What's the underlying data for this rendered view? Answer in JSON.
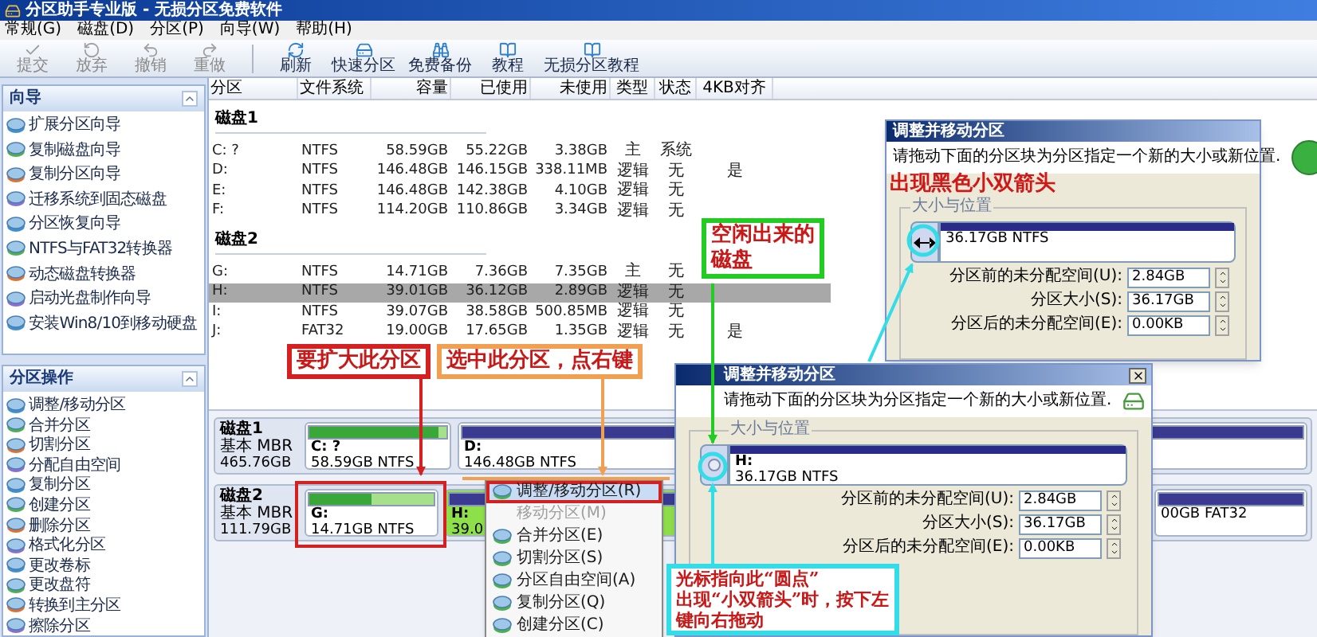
{
  "window": {
    "title": "分区助手专业版 - 无损分区免费软件"
  },
  "menu": [
    "常规(G)",
    "磁盘(D)",
    "分区(P)",
    "向导(W)",
    "帮助(H)"
  ],
  "toolbar": [
    {
      "label": "提交",
      "disabled": true
    },
    {
      "label": "放弃",
      "disabled": true
    },
    {
      "label": "撤销",
      "disabled": true
    },
    {
      "label": "重做",
      "disabled": true
    },
    {
      "label": "刷新",
      "disabled": false
    },
    {
      "label": "快速分区",
      "disabled": false
    },
    {
      "label": "免费备份",
      "disabled": false
    },
    {
      "label": "教程",
      "disabled": false
    },
    {
      "label": "无损分区教程",
      "disabled": false
    }
  ],
  "sidebar": [
    {
      "title": "向导",
      "items": [
        "扩展分区向导",
        "复制磁盘向导",
        "复制分区向导",
        "迁移系统到固态磁盘",
        "分区恢复向导",
        "NTFS与FAT32转换器",
        "动态磁盘转换器",
        "启动光盘制作向导",
        "安装Win8/10到移动硬盘"
      ]
    },
    {
      "title": "分区操作",
      "items": [
        "调整/移动分区",
        "合并分区",
        "切割分区",
        "分配自由空间",
        "复制分区",
        "创建分区",
        "删除分区",
        "格式化分区",
        "更改卷标",
        "更改盘符",
        "转换到主分区",
        "擦除分区"
      ]
    }
  ],
  "table": {
    "columns": [
      "分区",
      "文件系统",
      "容量",
      "已使用",
      "未使用",
      "类型",
      "状态",
      "4KB对齐"
    ],
    "groups": [
      {
        "name": "磁盘1",
        "rows": [
          {
            "cells": [
              "C: ?",
              "NTFS",
              "58.59GB",
              "55.22GB",
              "3.38GB",
              "主",
              "系统",
              ""
            ],
            "selected": false
          },
          {
            "cells": [
              "D:",
              "NTFS",
              "146.48GB",
              "146.15GB",
              "338.11MB",
              "逻辑",
              "无",
              "是"
            ],
            "selected": false
          },
          {
            "cells": [
              "E:",
              "NTFS",
              "146.48GB",
              "142.38GB",
              "4.10GB",
              "逻辑",
              "无",
              ""
            ],
            "selected": false
          },
          {
            "cells": [
              "F:",
              "NTFS",
              "114.20GB",
              "110.86GB",
              "3.34GB",
              "逻辑",
              "无",
              ""
            ],
            "selected": false
          }
        ]
      },
      {
        "name": "磁盘2",
        "rows": [
          {
            "cells": [
              "G:",
              "NTFS",
              "14.71GB",
              "7.36GB",
              "7.35GB",
              "主",
              "无",
              ""
            ],
            "selected": false
          },
          {
            "cells": [
              "H:",
              "NTFS",
              "39.01GB",
              "36.12GB",
              "2.89GB",
              "逻辑",
              "无",
              ""
            ],
            "selected": true
          },
          {
            "cells": [
              "I:",
              "NTFS",
              "39.07GB",
              "38.58GB",
              "500.85MB",
              "逻辑",
              "无",
              ""
            ],
            "selected": false
          },
          {
            "cells": [
              "J:",
              "FAT32",
              "19.00GB",
              "17.65GB",
              "1.35GB",
              "逻辑",
              "无",
              "是"
            ],
            "selected": false
          }
        ]
      }
    ]
  },
  "disks": [
    {
      "name": "磁盘1",
      "type": "基本 MBR",
      "size": "465.76GB",
      "partitions": [
        {
          "label": "C: ?",
          "info": "58.59GB NTFS",
          "level": 0.94,
          "selected": false
        },
        {
          "label": "D:",
          "info": "146.48GB NTFS",
          "level": 1,
          "selected": false
        }
      ]
    },
    {
      "name": "磁盘2",
      "type": "基本 MBR",
      "size": "111.79GB",
      "partitions": [
        {
          "label": "G:",
          "info": "14.71GB NTFS",
          "level": 0.5,
          "selected": false
        },
        {
          "label": "H:",
          "info": "39.0",
          "level": 1,
          "selected": true
        },
        {
          "info": "00GB FAT32",
          "level": 1,
          "selected": false
        }
      ]
    }
  ],
  "context_menu": [
    {
      "label": "调整/移动分区(R)",
      "disabled": false,
      "selected": true
    },
    {
      "label": "移动分区(M)",
      "disabled": true,
      "selected": false
    },
    {
      "label": "合并分区(E)",
      "disabled": false,
      "selected": false
    },
    {
      "label": "切割分区(S)",
      "disabled": false,
      "selected": false
    },
    {
      "label": "分区自由空间(A)",
      "disabled": false,
      "selected": false
    },
    {
      "label": "复制分区(Q)",
      "disabled": false,
      "selected": false
    },
    {
      "label": "创建分区(C)",
      "disabled": false,
      "selected": false
    }
  ],
  "dialogs": [
    {
      "title": "调整并移动分区",
      "instruction": "请拖动下面的分区块为分区指定一个新的大小或新位置.",
      "note": "出现黑色小双箭头",
      "group": "大小与位置",
      "partition": {
        "info": "36.17GB NTFS"
      },
      "fields": [
        {
          "label": "分区前的未分配空间(U):",
          "value": "2.84GB"
        },
        {
          "label": "分区大小(S):",
          "value": "36.17GB"
        },
        {
          "label": "分区后的未分配空间(E):",
          "value": "0.00KB"
        }
      ]
    },
    {
      "title": "调整并移动分区",
      "instruction": "请拖动下面的分区块为分区指定一个新的大小或新位置.",
      "group": "大小与位置",
      "partition": {
        "label": "H:",
        "info": "36.17GB NTFS"
      },
      "fields": [
        {
          "label": "分区前的未分配空间(U):",
          "value": "2.84GB"
        },
        {
          "label": "分区大小(S):",
          "value": "36.17GB"
        },
        {
          "label": "分区后的未分配空间(E):",
          "value": "0.00KB"
        }
      ]
    }
  ],
  "annotations": [
    {
      "lines": [
        "要扩大此分区"
      ],
      "color": "#d42020"
    },
    {
      "lines": [
        "选中此分区，点右键"
      ],
      "color": "#f0a050"
    },
    {
      "lines": [
        "空闲出来的",
        "磁盘"
      ],
      "color": "#22cc22"
    },
    {
      "lines": [
        "光标指向此“圆点”",
        "出现“小双箭头”时，按下左",
        "键向右拖动"
      ],
      "color": "#33dde8"
    }
  ]
}
